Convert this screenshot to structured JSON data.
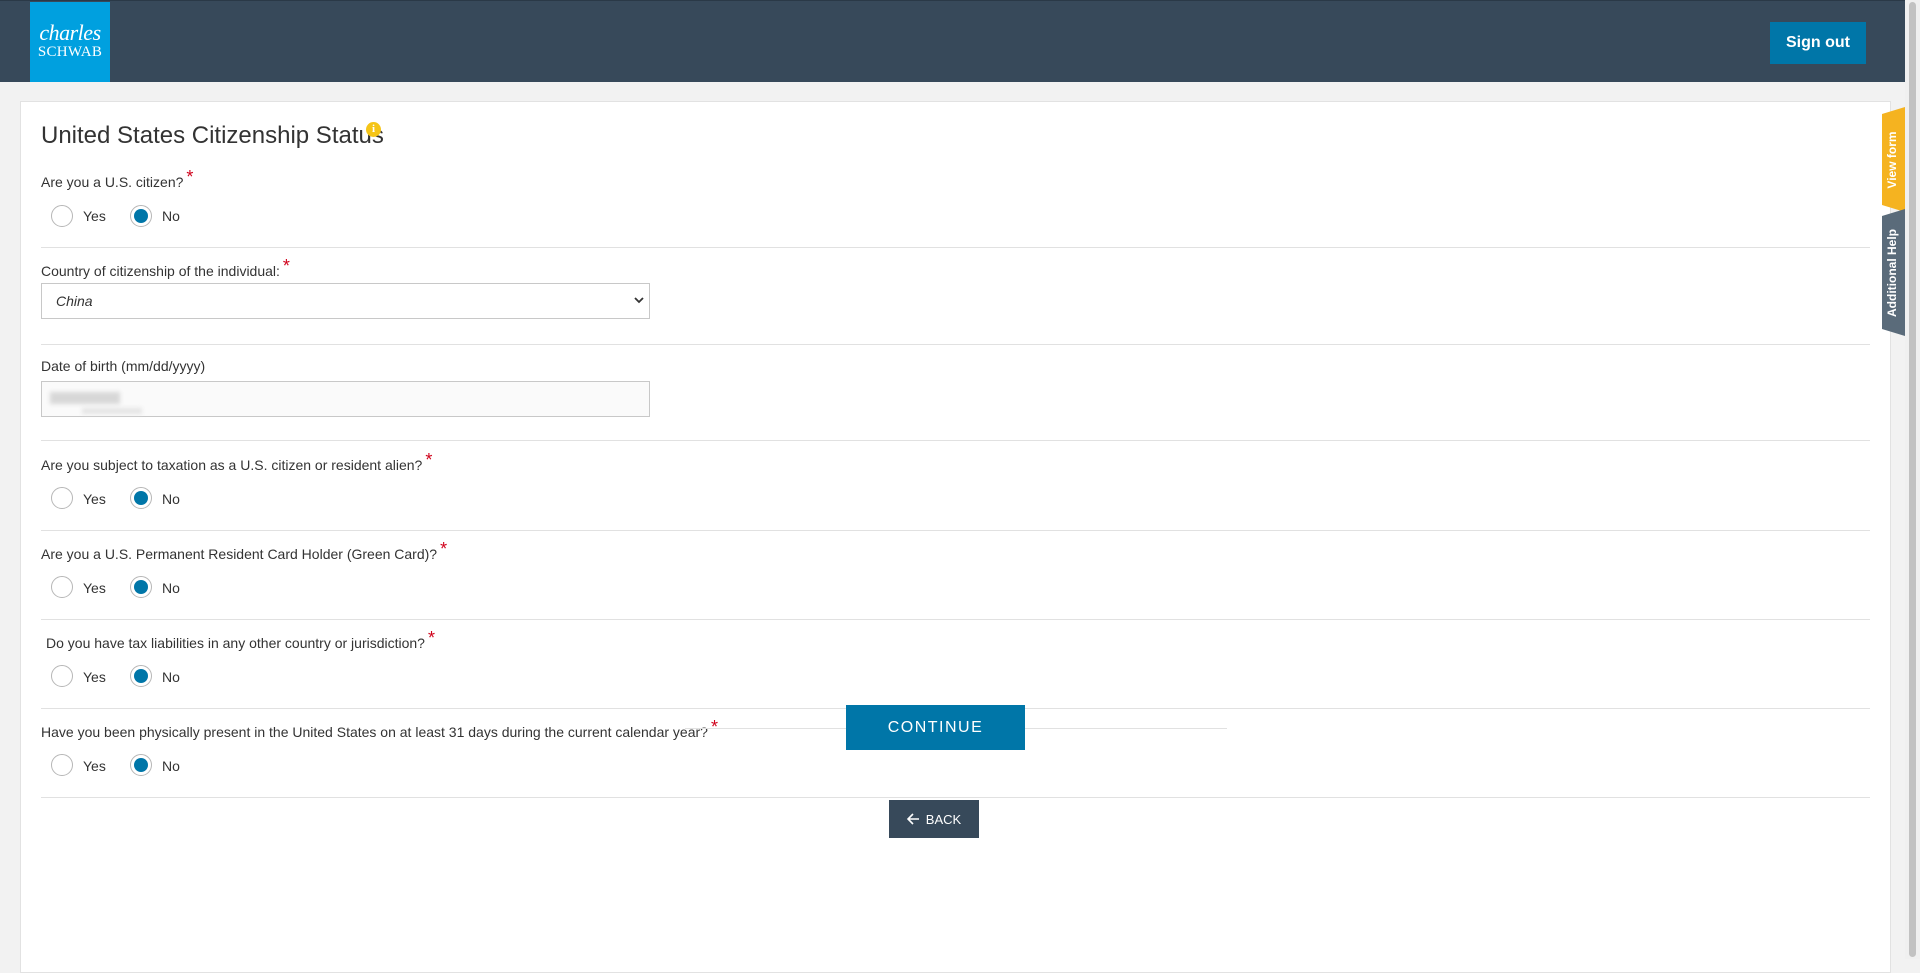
{
  "header": {
    "logo_line1": "charles",
    "logo_line2": "SCHWAB",
    "signout_label": "Sign out"
  },
  "side_tabs": {
    "view_form": "View form",
    "additional_help": "Additional Help"
  },
  "form": {
    "title": "United States Citizenship Status",
    "required_mark": "*",
    "q_citizen": {
      "label": "Are you a U.S. citizen?",
      "yes": "Yes",
      "no": "No",
      "selected": "No"
    },
    "country": {
      "label": "Country of citizenship of the individual:",
      "value": "China"
    },
    "dob": {
      "label": "Date of birth (mm/dd/yyyy)"
    },
    "q_taxation": {
      "label": "Are you subject to taxation as a U.S. citizen or resident alien?",
      "yes": "Yes",
      "no": "No",
      "selected": "No"
    },
    "q_greencard": {
      "label": "Are you a U.S. Permanent Resident Card Holder (Green Card)?",
      "yes": "Yes",
      "no": "No",
      "selected": "No"
    },
    "q_tax_liab": {
      "label": "Do you have tax liabilities in any other country or jurisdiction?",
      "yes": "Yes",
      "no": "No",
      "selected": "No"
    },
    "q_present": {
      "label": "Have you been physically present in the United States on at least 31 days during the current calendar year?",
      "yes": "Yes",
      "no": "No",
      "selected": "No"
    },
    "continue_label": "CONTINUE",
    "back_label": "BACK"
  },
  "colors": {
    "header_bg": "#37495a",
    "logo_bg": "#00a0df",
    "primary_button": "#0076a8",
    "radio_checked": "#0076a8",
    "required_mark": "#d0021b",
    "info_icon": "#f5c518",
    "view_form_tab": "#f5b320",
    "help_tab": "#5a6b7a"
  },
  "icons": {
    "info": "info-icon",
    "select_chevron": "chevron-down-icon",
    "back_arrow": "arrow-left-icon"
  }
}
